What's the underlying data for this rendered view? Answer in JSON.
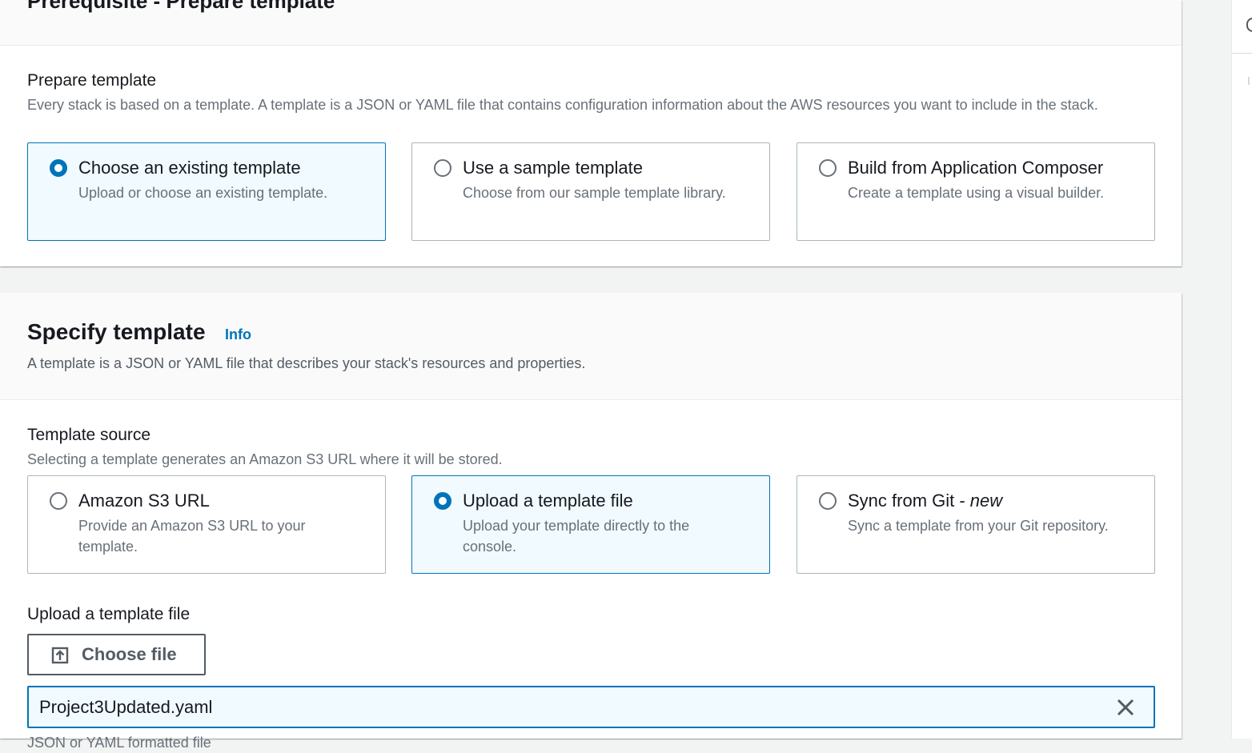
{
  "prerequisite": {
    "section_title": "Prerequisite - Prepare template",
    "field_label": "Prepare template",
    "field_description": "Every stack is based on a template. A template is a JSON or YAML file that contains configuration information about the AWS resources you want to include in the stack.",
    "options": [
      {
        "title": "Choose an existing template",
        "description": "Upload or choose an existing template.",
        "selected": true
      },
      {
        "title": "Use a sample template",
        "description": "Choose from our sample template library.",
        "selected": false
      },
      {
        "title": "Build from Application Composer",
        "description": "Create a template using a visual builder.",
        "selected": false
      }
    ]
  },
  "specify": {
    "title": "Specify template",
    "info_link": "Info",
    "description": "A template is a JSON or YAML file that describes your stack's resources and properties.",
    "source_label": "Template source",
    "source_description": "Selecting a template generates an Amazon S3 URL where it will be stored.",
    "sources": [
      {
        "title": "Amazon S3 URL",
        "title_suffix": "",
        "description": "Provide an Amazon S3 URL to your template.",
        "selected": false
      },
      {
        "title": "Upload a template file",
        "title_suffix": "",
        "description": "Upload your template directly to the console.",
        "selected": true
      },
      {
        "title": "Sync from Git - ",
        "title_suffix": "new",
        "description": "Sync a template from your Git repository.",
        "selected": false
      }
    ],
    "upload_label": "Upload a template file",
    "choose_file_label": "Choose file",
    "file_name": "Project3Updated.yaml",
    "file_hint": "JSON or YAML formatted file"
  },
  "colors": {
    "accent": "#0073bb",
    "selected_bg": "#f1faff",
    "muted_text": "#687078"
  },
  "icons": [
    "upload-icon",
    "close-icon",
    "radio-icon"
  ]
}
